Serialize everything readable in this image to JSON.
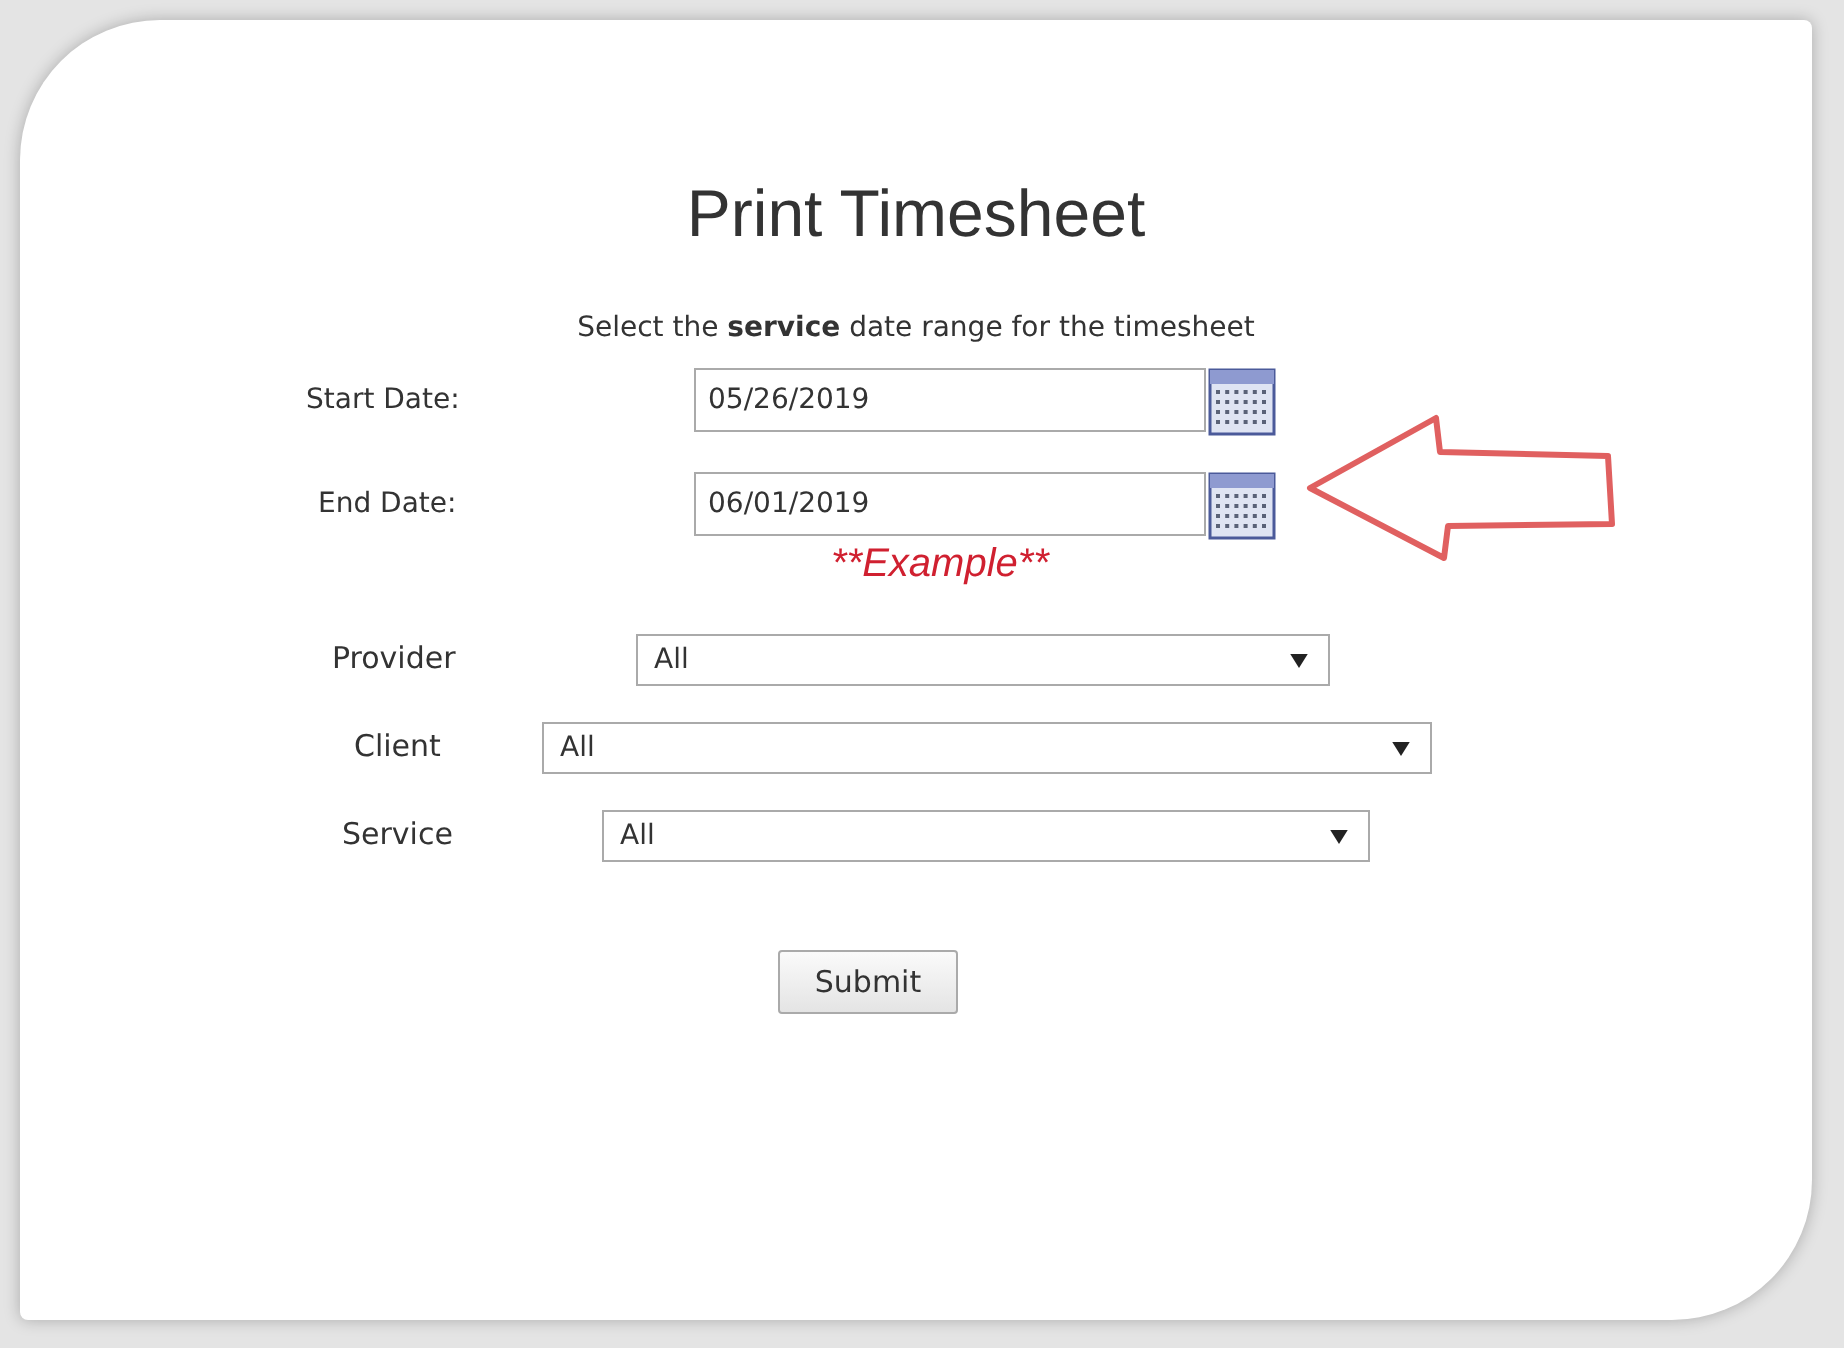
{
  "title": "Print Timesheet",
  "instruction": "Select the **service** date range for the timesheet",
  "date_fields": [
    {
      "label": "Start Date:",
      "value": "05/26/2019"
    },
    {
      "label": "End Date:",
      "value": "06/01/2019"
    }
  ],
  "note": "**Example**",
  "dropdowns": [
    {
      "label": "Provider",
      "value": "All"
    },
    {
      "label": "Client",
      "value": "All"
    },
    {
      "label": "Service",
      "value": "All"
    }
  ],
  "submit_button": "Submit"
}
